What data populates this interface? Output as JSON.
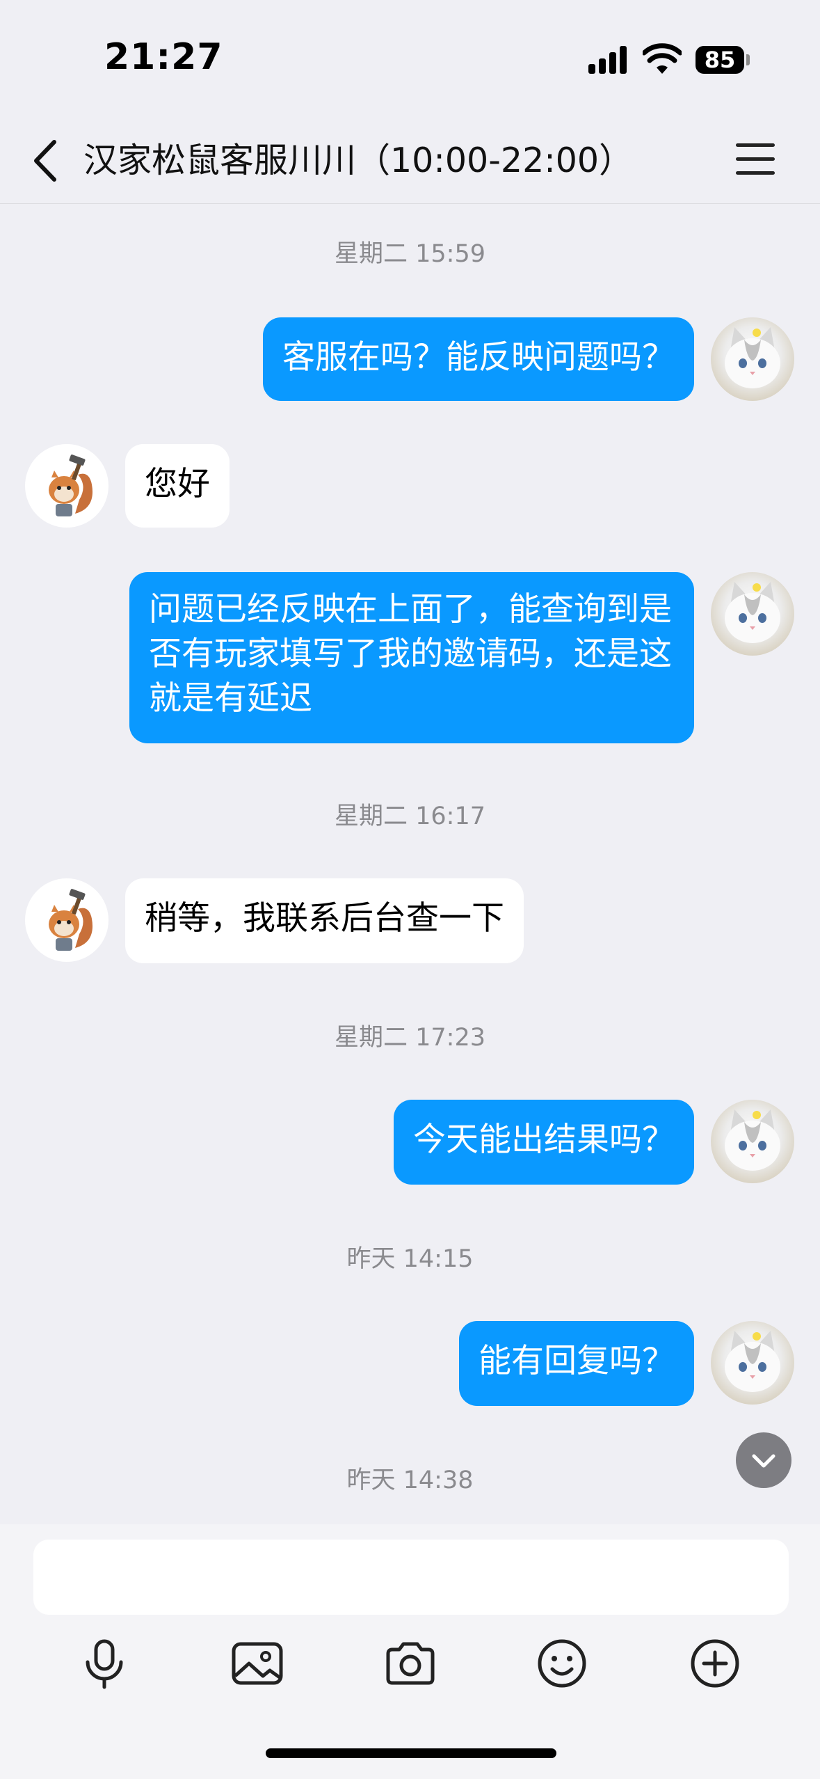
{
  "status_bar": {
    "time": "21:27",
    "battery": "85"
  },
  "header": {
    "title": "汉家松鼠客服川川（10:00-22:00）"
  },
  "messages": [
    {
      "type": "timestamp",
      "text": "星期二 15:59"
    },
    {
      "type": "outgoing",
      "text": "客服在吗？能反映问题吗？"
    },
    {
      "type": "incoming",
      "text": "您好"
    },
    {
      "type": "outgoing",
      "text": "问题已经反映在上面了，能查询到是否有玩家填写了我的邀请码，还是这就是有延迟"
    },
    {
      "type": "timestamp",
      "text": "星期二 16:17"
    },
    {
      "type": "incoming",
      "text": "稍等，我联系后台查一下"
    },
    {
      "type": "timestamp",
      "text": "星期二 17:23"
    },
    {
      "type": "outgoing",
      "text": "今天能出结果吗？"
    },
    {
      "type": "timestamp",
      "text": "昨天 14:15"
    },
    {
      "type": "outgoing",
      "text": "能有回复吗？"
    },
    {
      "type": "timestamp",
      "text": "昨天 14:38"
    }
  ],
  "input": {
    "placeholder": ""
  },
  "toolbar": [
    "mic-icon",
    "image-icon",
    "camera-icon",
    "emoji-icon",
    "plus-icon"
  ],
  "colors": {
    "outgoing_bubble": "#0a99ff",
    "incoming_bubble": "#ffffff",
    "background": "#efeff4"
  }
}
